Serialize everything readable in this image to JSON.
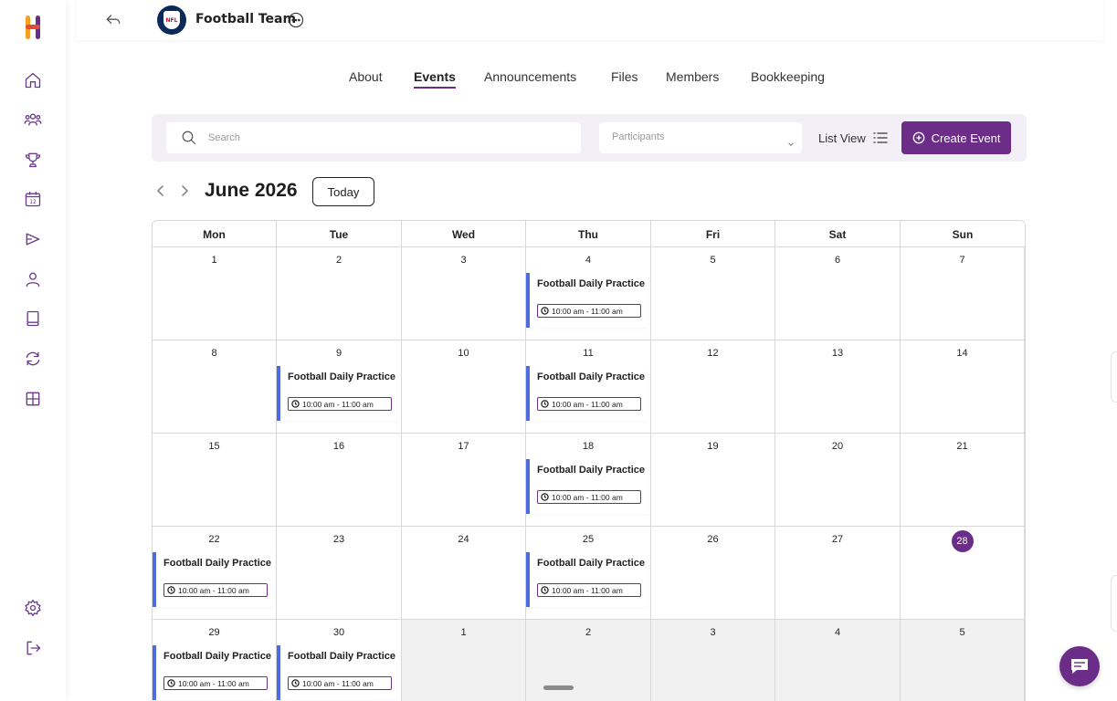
{
  "brand": {
    "accent": "#6b2d87",
    "event_bar": "#4e6ce0"
  },
  "sidebar": {
    "logo": "H",
    "items": [
      {
        "name": "home-icon"
      },
      {
        "name": "groups-icon"
      },
      {
        "name": "trophy-icon"
      },
      {
        "name": "calendar-icon",
        "label": "12"
      },
      {
        "name": "megaphone-icon"
      },
      {
        "name": "user-icon"
      },
      {
        "name": "book-icon"
      },
      {
        "name": "sync-icon"
      },
      {
        "name": "grid-icon"
      }
    ],
    "bottom": [
      {
        "name": "settings-icon"
      },
      {
        "name": "logout-icon"
      }
    ]
  },
  "header": {
    "team_name": "Football Team",
    "team_logo_text": "NFL"
  },
  "tabs": [
    {
      "label": "About",
      "active": false
    },
    {
      "label": "Events",
      "active": true
    },
    {
      "label": "Announcements",
      "active": false
    },
    {
      "label": "Files",
      "active": false
    },
    {
      "label": "Members",
      "active": false
    },
    {
      "label": "Bookkeeping",
      "active": false
    }
  ],
  "toolbar": {
    "search_placeholder": "Search",
    "participants_placeholder": "Participants",
    "list_view_label": "List View",
    "create_label": "Create Event"
  },
  "calendar": {
    "month_label": "June 2026",
    "today_label": "Today",
    "weekdays": [
      "Mon",
      "Tue",
      "Wed",
      "Thu",
      "Fri",
      "Sat",
      "Sun"
    ],
    "today_day": "28",
    "event_title": "Football Daily Practice",
    "event_time": "10:00 am - 11:00 am",
    "weeks": [
      [
        {
          "day": "1"
        },
        {
          "day": "2"
        },
        {
          "day": "3"
        },
        {
          "day": "4",
          "event": true
        },
        {
          "day": "5"
        },
        {
          "day": "6"
        },
        {
          "day": "7"
        }
      ],
      [
        {
          "day": "8"
        },
        {
          "day": "9",
          "event": true
        },
        {
          "day": "10"
        },
        {
          "day": "11",
          "event": true
        },
        {
          "day": "12"
        },
        {
          "day": "13"
        },
        {
          "day": "14"
        }
      ],
      [
        {
          "day": "15"
        },
        {
          "day": "16"
        },
        {
          "day": "17"
        },
        {
          "day": "18",
          "event": true
        },
        {
          "day": "19"
        },
        {
          "day": "20"
        },
        {
          "day": "21"
        }
      ],
      [
        {
          "day": "22",
          "event": true
        },
        {
          "day": "23"
        },
        {
          "day": "24"
        },
        {
          "day": "25",
          "event": true
        },
        {
          "day": "26"
        },
        {
          "day": "27"
        },
        {
          "day": "28",
          "today": true
        }
      ],
      [
        {
          "day": "29",
          "event": true
        },
        {
          "day": "30",
          "event": true
        },
        {
          "day": "1",
          "other": true
        },
        {
          "day": "2",
          "other": true
        },
        {
          "day": "3",
          "other": true
        },
        {
          "day": "4",
          "other": true
        },
        {
          "day": "5",
          "other": true
        }
      ]
    ]
  }
}
